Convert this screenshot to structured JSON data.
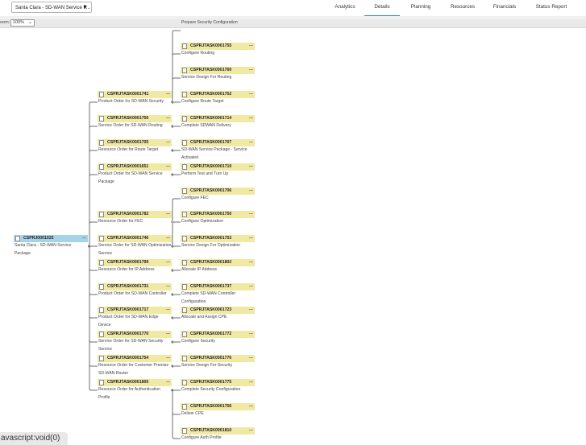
{
  "header": {
    "project_select": "Santa Clara - SD-WAN Service P...",
    "tabs": [
      {
        "label": "Analytics",
        "active": false
      },
      {
        "label": "Details",
        "active": true
      },
      {
        "label": "Planning",
        "active": false
      },
      {
        "label": "Resources",
        "active": false
      },
      {
        "label": "Financials",
        "active": false
      },
      {
        "label": "Status Report",
        "active": false
      }
    ]
  },
  "zoom": {
    "label": "oom:",
    "value": "100%"
  },
  "nodes": [
    {
      "id": "CSPRJ0001025",
      "desc": "Santa Clara - SD-WAN Service Package",
      "color": "blue"
    },
    {
      "id": "CSPRJTASK0001741",
      "desc": "Product Order for SD-WAN Security"
    },
    {
      "id": "CSPRJTASK0001756",
      "desc": "Service Order for SD-WAN Routing"
    },
    {
      "id": "CSPRJTASK0001705",
      "desc": "Resource Order for Route Target"
    },
    {
      "id": "CSPRJTASK0001651",
      "desc": "Product Order for SD-WAN Service Package"
    },
    {
      "id": "CSPRJTASK0001782",
      "desc": "Resource Order for FEC"
    },
    {
      "id": "CSPRJTASK0001746",
      "desc": "Service Order for SD-WAN Optimization Service"
    },
    {
      "id": "CSPRJTASK0001799",
      "desc": "Resource Order for IP Address"
    },
    {
      "id": "CSPRJTASK0001731",
      "desc": "Product Order for SD-WAN Controller"
    },
    {
      "id": "CSPRJTASK0001717",
      "desc": "Product Order for SD-WAN Edge Device"
    },
    {
      "id": "CSPRJTASK0001770",
      "desc": "Service Order for SD-WAN Security Service"
    },
    {
      "id": "CSPRJTASK0001754",
      "desc": "Resource Order for Customer Premise SD-WAN Router"
    },
    {
      "id": "CSPRJTASK0001805",
      "desc": "Resource Order for Authentication Profile"
    },
    {
      "id": "",
      "desc": "Prepare Security Configuration"
    },
    {
      "id": "CSPRJTASK0001755",
      "desc": "Configure Routing"
    },
    {
      "id": "CSPRJTASK0001760",
      "desc": "Service Design For Routing"
    },
    {
      "id": "CSPRJTASK0001752",
      "desc": "Configure Route Target"
    },
    {
      "id": "CSPRJTASK0001714",
      "desc": "Complete SDWAN Delivery"
    },
    {
      "id": "CSPRJTASK0001707",
      "desc": "SD-WAN Service Package - Service Activated"
    },
    {
      "id": "CSPRJTASK0001710",
      "desc": "Perform Test and Turn Up"
    },
    {
      "id": "CSPRJTASK0001706",
      "desc": "Configure FEC"
    },
    {
      "id": "CSPRJTASK0001750",
      "desc": "Configure Optimization"
    },
    {
      "id": "CSPRJTASK0001753",
      "desc": "Service Design For Optimization"
    },
    {
      "id": "CSPRJTASK0001802",
      "desc": "Allocate IP Address"
    },
    {
      "id": "CSPRJTASK0001737",
      "desc": "Complete SD-WAN Controller Configuration"
    },
    {
      "id": "CSPRJTASK0001723",
      "desc": "Allocate and Assign CPE"
    },
    {
      "id": "CSPRJTASK0001772",
      "desc": "Configure Security"
    },
    {
      "id": "CSPRJTASK0001776",
      "desc": "Service Design For Security"
    },
    {
      "id": "CSPRJTASK0001775",
      "desc": "Complete Security Configuration"
    },
    {
      "id": "CSPRJTASK0001756",
      "desc": "Deliver CPE"
    },
    {
      "id": "CSPRJTASK0001810",
      "desc": "Configure Auth Profile"
    }
  ],
  "statusbar": {
    "text": "avascript:void(0)"
  }
}
